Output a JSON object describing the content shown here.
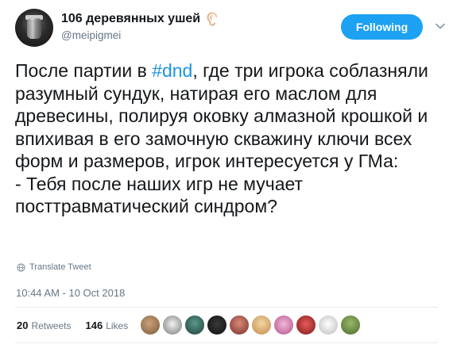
{
  "user": {
    "name": "106 деревянных ушей",
    "handle": "@meipigmei"
  },
  "follow_button": {
    "label": "Following"
  },
  "tweet": {
    "text_before": "После партии в ",
    "hashtag": "#dnd",
    "text_after": ", где три игрока соблазняли разумный сундук, натирая его маслом для древесины, полируя оковку алмазной крошкой и впихивая в его замочную скважину ключи всех форм и размеров, игрок интересуется у ГМа:\n- Тебя после наших игр не мучает посттравматический синдром?"
  },
  "translate_label": "Translate Tweet",
  "timestamp": "10:44 AM - 10 Oct 2018",
  "stats": {
    "retweets_count": "20",
    "retweets_label": "Retweets",
    "likes_count": "146",
    "likes_label": "Likes"
  },
  "colors": {
    "accent": "#1da1f2",
    "hashtag": "#1b95e0",
    "secondary_text": "#657786"
  },
  "icons": [
    "ear-icon",
    "chevron-down-icon",
    "globe-icon"
  ]
}
